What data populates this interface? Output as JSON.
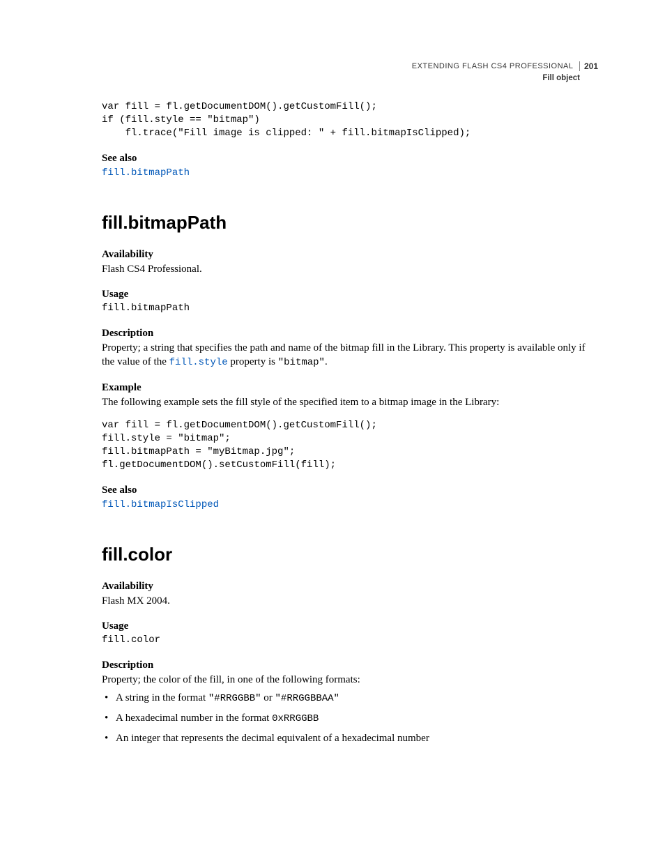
{
  "header": {
    "title": "EXTENDING FLASH CS4 PROFESSIONAL",
    "page_number": "201",
    "subtitle": "Fill object"
  },
  "intro_code": "var fill = fl.getDocumentDOM().getCustomFill();\nif (fill.style == \"bitmap\")\n    fl.trace(\"Fill image is clipped: \" + fill.bitmapIsClipped);",
  "see_also_1": {
    "label": "See also",
    "link": "fill.bitmapPath"
  },
  "section1": {
    "heading": "fill.bitmapPath",
    "availability_label": "Availability",
    "availability_text": "Flash CS4 Professional.",
    "usage_label": "Usage",
    "usage_code": "fill.bitmapPath",
    "description_label": "Description",
    "description_pre": "Property; a string that specifies the path and name of the bitmap fill in the Library. This property is available only if the value of the ",
    "description_link": "fill.style",
    "description_mid": " property is ",
    "description_code": "\"bitmap\"",
    "description_post": ".",
    "example_label": "Example",
    "example_text": "The following example sets the fill style of the specified item to a bitmap image in the Library:",
    "example_code": "var fill = fl.getDocumentDOM().getCustomFill();\nfill.style = \"bitmap\";\nfill.bitmapPath = \"myBitmap.jpg\";\nfl.getDocumentDOM().setCustomFill(fill);",
    "see_also_label": "See also",
    "see_also_link": "fill.bitmapIsClipped"
  },
  "section2": {
    "heading": "fill.color",
    "availability_label": "Availability",
    "availability_text": "Flash MX 2004.",
    "usage_label": "Usage",
    "usage_code": "fill.color",
    "description_label": "Description",
    "description_text": "Property; the color of the fill, in one of the following formats:",
    "bullets": {
      "b1_pre": "A string in the format ",
      "b1_code1": "\"#RRGGBB\"",
      "b1_mid": " or ",
      "b1_code2": "\"#RRGGBBAA\"",
      "b2_pre": "A hexadecimal number in the format ",
      "b2_code": "0xRRGGBB",
      "b3": "An integer that represents the decimal equivalent of a hexadecimal number"
    }
  }
}
